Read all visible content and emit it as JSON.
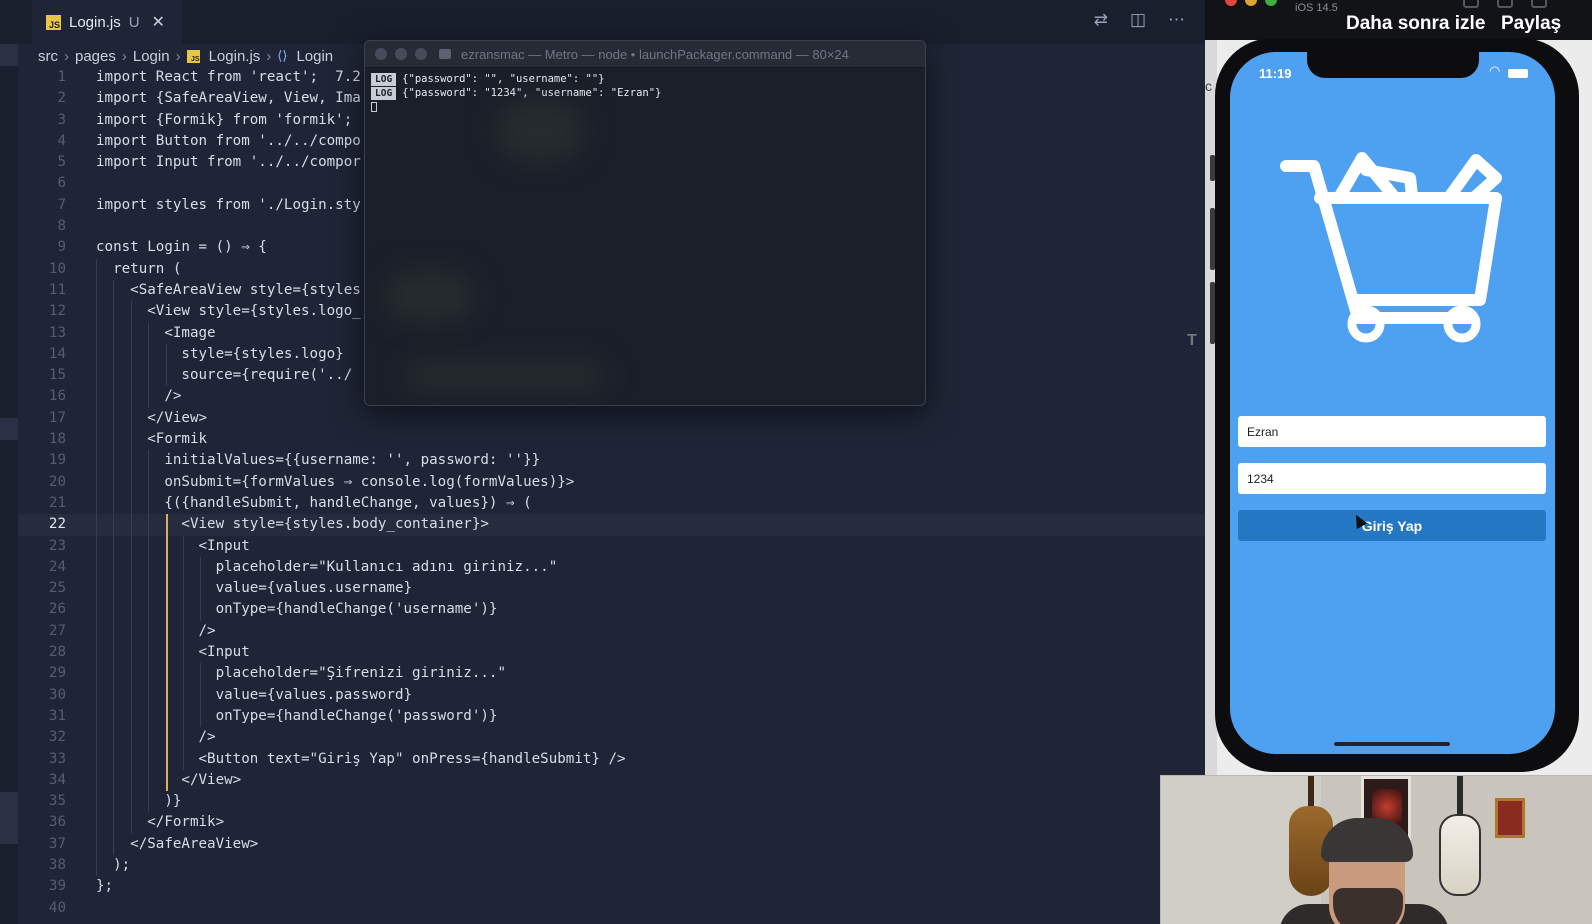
{
  "editor": {
    "tab": {
      "filename": "Login.js",
      "status": "U",
      "close": "✕"
    },
    "breadcrumb": [
      "src",
      "pages",
      "Login",
      "Login.js",
      "Login"
    ],
    "current_line": 22,
    "lines": [
      {
        "n": "1",
        "t": "import React from 'react';  7.2"
      },
      {
        "n": "2",
        "t": "import {SafeAreaView, View, Ima"
      },
      {
        "n": "3",
        "t": "import {Formik} from 'formik';"
      },
      {
        "n": "4",
        "t": "import Button from '../../compo"
      },
      {
        "n": "5",
        "t": "import Input from '../../compor"
      },
      {
        "n": "6",
        "t": ""
      },
      {
        "n": "7",
        "t": "import styles from './Login.sty"
      },
      {
        "n": "8",
        "t": ""
      },
      {
        "n": "9",
        "t": "const Login = () ⇒ {"
      },
      {
        "n": "10",
        "t": "  return ("
      },
      {
        "n": "11",
        "t": "    <SafeAreaView style={styles"
      },
      {
        "n": "12",
        "t": "      <View style={styles.logo_"
      },
      {
        "n": "13",
        "t": "        <Image"
      },
      {
        "n": "14",
        "t": "          style={styles.logo}"
      },
      {
        "n": "15",
        "t": "          source={require('../"
      },
      {
        "n": "16",
        "t": "        />"
      },
      {
        "n": "17",
        "t": "      </View>"
      },
      {
        "n": "18",
        "t": "      <Formik"
      },
      {
        "n": "19",
        "t": "        initialValues={{username: '', password: ''}}"
      },
      {
        "n": "20",
        "t": "        onSubmit={formValues ⇒ console.log(formValues)}>"
      },
      {
        "n": "21",
        "t": "        {({handleSubmit, handleChange, values}) ⇒ ("
      },
      {
        "n": "22",
        "t": "          <View style={styles.body_container}>"
      },
      {
        "n": "23",
        "t": "            <Input"
      },
      {
        "n": "24",
        "t": "              placeholder=\"Kullanıcı adını giriniz...\""
      },
      {
        "n": "25",
        "t": "              value={values.username}"
      },
      {
        "n": "26",
        "t": "              onType={handleChange('username')}"
      },
      {
        "n": "27",
        "t": "            />"
      },
      {
        "n": "28",
        "t": "            <Input"
      },
      {
        "n": "29",
        "t": "              placeholder=\"Şifrenizi giriniz...\""
      },
      {
        "n": "30",
        "t": "              value={values.password}"
      },
      {
        "n": "31",
        "t": "              onType={handleChange('password')}"
      },
      {
        "n": "32",
        "t": "            />"
      },
      {
        "n": "33",
        "t": "            <Button text=\"Giriş Yap\" onPress={handleSubmit} />"
      },
      {
        "n": "34",
        "t": "          </View>"
      },
      {
        "n": "35",
        "t": "        )}"
      },
      {
        "n": "36",
        "t": "      </Formik>"
      },
      {
        "n": "37",
        "t": "    </SafeAreaView>"
      },
      {
        "n": "38",
        "t": "  );"
      },
      {
        "n": "39",
        "t": "};"
      },
      {
        "n": "40",
        "t": ""
      }
    ]
  },
  "terminal": {
    "title": "ezransmac — Metro — node • launchPackager.command — 80×24",
    "logs": [
      {
        "badge": "LOG",
        "text": "{\"password\": \"\", \"username\": \"\"}"
      },
      {
        "badge": "LOG",
        "text": "{\"password\": \"1234\", \"username\": \"Ezran\"}"
      }
    ]
  },
  "topbar": {
    "ios_version": "iOS 14.5",
    "watch_later": "Daha sonra izle",
    "share": "Paylaş"
  },
  "simulator": {
    "side_letter": "c",
    "side_t": "T",
    "time": "11:19",
    "username_value": "Ezran",
    "password_value": "1234",
    "login_button": "Giriş Yap",
    "screen_color": "#4ea1f1",
    "button_color": "#2478c3"
  },
  "icons": {
    "logo": "shopping-cart-icon",
    "tab_actions": [
      "source-control-icon",
      "split-editor-icon",
      "more-icon"
    ]
  }
}
